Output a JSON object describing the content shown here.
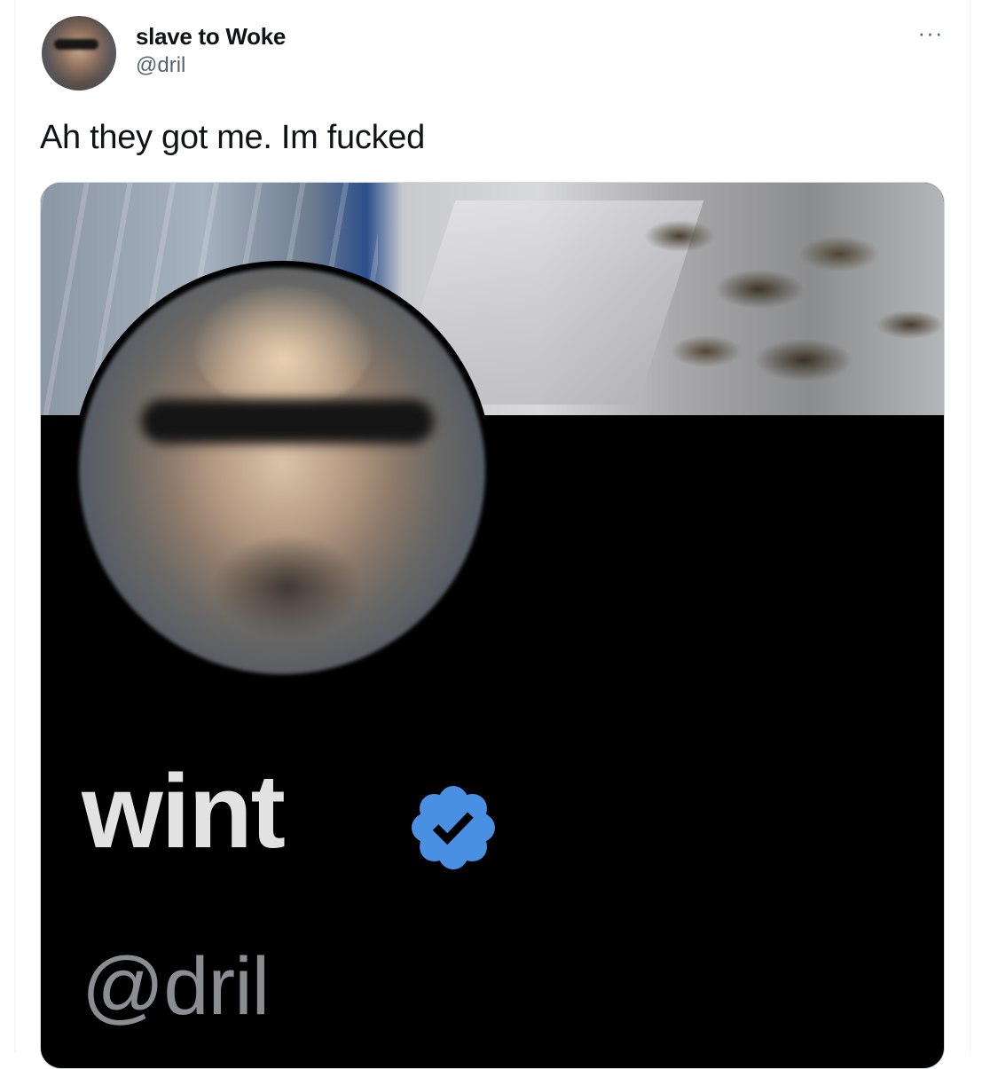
{
  "author": {
    "display_name": "slave to Woke",
    "handle": "@dril",
    "avatar": "avatar-photo"
  },
  "menu": {
    "more_label": "···",
    "icon": "more-horizontal-icon"
  },
  "tweet": {
    "text": "Ah they got me. Im fucked"
  },
  "media": {
    "profile_name": "wint",
    "profile_handle": "@dril",
    "verified_icon": "verified-badge-icon",
    "verified_color": "#4a90e2"
  }
}
